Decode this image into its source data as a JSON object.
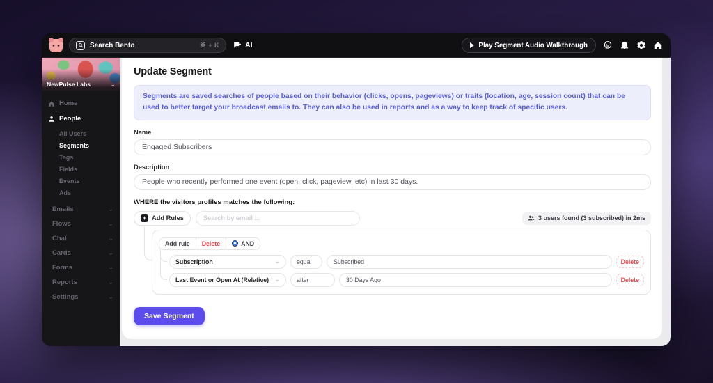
{
  "topbar": {
    "search_placeholder": "Search Bento",
    "search_shortcut": "⌘ + K",
    "ai_label": "AI",
    "play_button_label": "Play Segment Audio Walkthrough"
  },
  "sidebar": {
    "workspace": "NewPulse Labs",
    "items": [
      {
        "label": "Home"
      },
      {
        "label": "People"
      }
    ],
    "people_children": [
      {
        "label": "All Users"
      },
      {
        "label": "Segments"
      },
      {
        "label": "Tags"
      },
      {
        "label": "Fields"
      },
      {
        "label": "Events"
      },
      {
        "label": "Ads"
      }
    ],
    "sections": [
      {
        "label": "Emails"
      },
      {
        "label": "Flows"
      },
      {
        "label": "Chat"
      },
      {
        "label": "Cards"
      },
      {
        "label": "Forms"
      },
      {
        "label": "Reports"
      },
      {
        "label": "Settings"
      }
    ]
  },
  "main": {
    "title": "Update Segment",
    "info_text": "Segments are saved searches of people based on their behavior (clicks, opens, pageviews) or traits (location, age, session count) that can be used to better target your broadcast emails to. They can also be used in reports and as a way to keep track of specific users.",
    "name_label": "Name",
    "name_value": "Engaged Subscribers",
    "description_label": "Description",
    "description_value": "People who recently performed one event (open, click, pageview, etc) in last 30 days.",
    "where_label": "WHERE the visitors profiles matches the following:",
    "add_rules_label": "Add Rules",
    "email_search_placeholder": "Search by email ...",
    "results_text": "3 users found (3 subscribed) in 2ms",
    "rule_group": {
      "add_rule_label": "Add rule",
      "delete_label": "Delete",
      "conjunction": "AND",
      "rules": [
        {
          "field": "Subscription",
          "operator": "equal",
          "value": "Subscribed",
          "delete_label": "Delete"
        },
        {
          "field": "Last Event or Open At (Relative)",
          "operator": "after",
          "value": "30 Days Ago",
          "delete_label": "Delete"
        }
      ]
    },
    "save_button_label": "Save Segment"
  },
  "colors": {
    "accent": "#5b4ceb",
    "danger": "#e5484d",
    "info_text": "#5a5fd6",
    "info_bg": "#edeefc",
    "topbar_bg": "#101013",
    "sidebar_bg": "#161619"
  }
}
